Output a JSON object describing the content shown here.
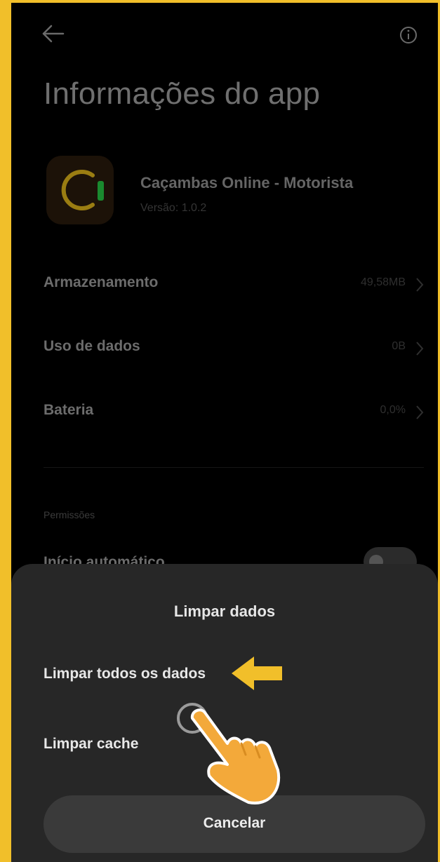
{
  "header": {
    "back_icon": "arrow-left-icon",
    "info_icon": "info-circle-icon",
    "title": "Informações do app"
  },
  "app": {
    "name": "Caçambas Online - Motorista",
    "version": "Versão: 1.0.2",
    "icon": "app-logo-icon"
  },
  "rows": [
    {
      "label": "Armazenamento",
      "value": "49,58MB"
    },
    {
      "label": "Uso de dados",
      "value": "0B"
    },
    {
      "label": "Bateria",
      "value": "0,0%"
    }
  ],
  "permissions": {
    "header": "Permissões",
    "autostart_label": "Início automático"
  },
  "dialog": {
    "title": "Limpar dados",
    "option_all": "Limpar todos os dados",
    "option_cache": "Limpar cache",
    "cancel_label": "Cancelar"
  },
  "overlay": {
    "arrow_icon": "arrow-pointer-left-icon",
    "hand_icon": "tap-hand-icon"
  },
  "colors": {
    "frame": "#f1bf2a",
    "background": "#000000",
    "sheet": "#272727",
    "logo_ring": "#c9a21a",
    "logo_accent": "#1faa3a",
    "hand": "#f3a93a"
  }
}
